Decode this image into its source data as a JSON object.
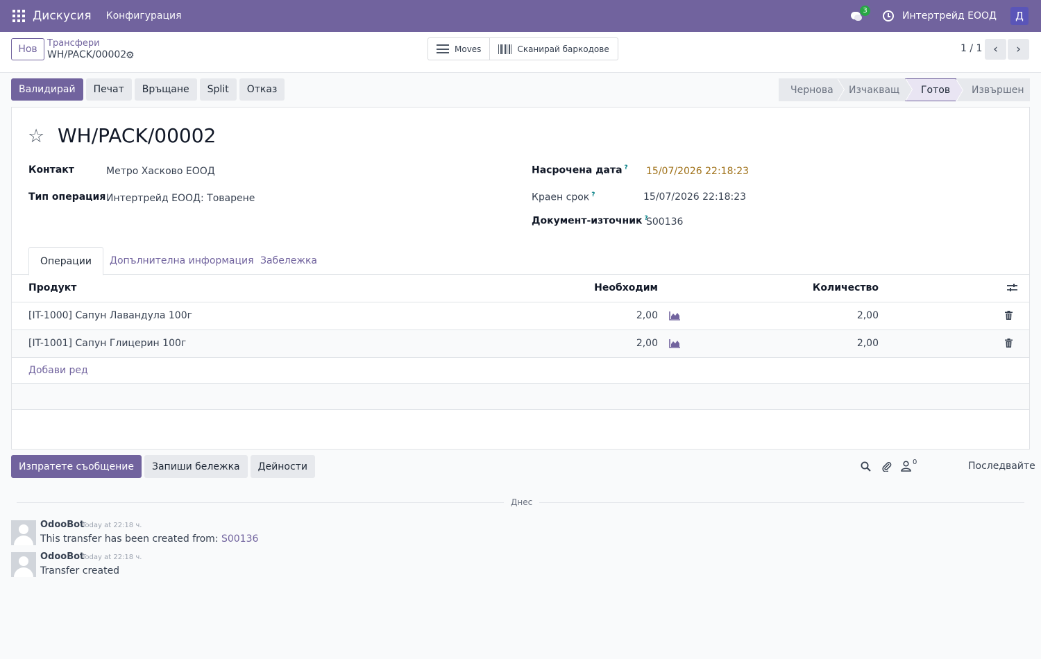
{
  "navbar": {
    "app_name": "Дискусия",
    "menu_config": "Конфигурация",
    "chat_count": "3",
    "company": "Интертрейд ЕООД",
    "avatar_letter": "Д",
    "bg_color": "#71639e"
  },
  "control": {
    "new_label": "Нов",
    "breadcrumb_parent": "Трансфери",
    "breadcrumb_current": "WH/PACK/00002",
    "smart_moves": "Moves",
    "smart_barcode": "Сканирай баркодове",
    "pager": "1 / 1",
    "pager_prev": "‹",
    "pager_next": "›"
  },
  "actions": {
    "validate": "Валидирай",
    "print": "Печат",
    "return": "Връщане",
    "split": "Split",
    "cancel": "Отказ"
  },
  "status": {
    "draft": "Чернова",
    "waiting": "Изчакващ",
    "ready": "Готов",
    "done": "Извършен",
    "active": "ready"
  },
  "form": {
    "title": "WH/PACK/00002",
    "contact_label": "Контакт",
    "contact_value": "Метро Хасково ЕООД",
    "op_type_label": "Тип операция",
    "op_type_value": "Интертрейд ЕООД: Товарене",
    "scheduled_label": "Насрочена дата",
    "scheduled_value": "15/07/2026 22:18:23",
    "deadline_label": "Краен срок",
    "deadline_value": "15/07/2026 22:18:23",
    "source_label": "Документ-източник",
    "source_value": "S00136",
    "help_mark": "?"
  },
  "tabs": {
    "operations": "Операции",
    "additional": "Допълнителна информация",
    "note": "Забележка"
  },
  "table": {
    "col_product": "Продукт",
    "col_demand": "Необходим",
    "col_quantity": "Количество",
    "rows": [
      {
        "product": "[IT-1000] Сапун Лавандула 100г",
        "demand": "2,00",
        "quantity": "2,00"
      },
      {
        "product": "[IT-1001] Сапун Глицерин 100г",
        "demand": "2,00",
        "quantity": "2,00"
      }
    ],
    "add_line": "Добави ред"
  },
  "chatter": {
    "send_message": "Изпратете съобщение",
    "log_note": "Запиши бележка",
    "activities": "Дейности",
    "followers_count": "0",
    "follow": "Последвайте",
    "day": "Днес",
    "messages": [
      {
        "author": "OdooBot",
        "time": "Today at 22:18 ч.",
        "text": "This transfer has been created from: ",
        "link": "S00136"
      },
      {
        "author": "OdooBot",
        "time": "Today at 22:18 ч.",
        "text": "Transfer created",
        "link": ""
      }
    ]
  }
}
